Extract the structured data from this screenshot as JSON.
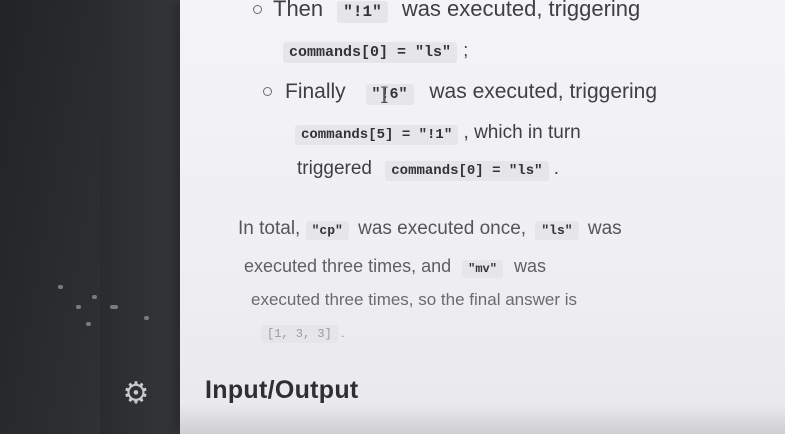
{
  "step_then": {
    "word": "Then",
    "cmd": "\"!1\"",
    "text": "was executed, triggering",
    "trigger": "commands[0] = \"ls\"",
    "punct": ";"
  },
  "step_finally": {
    "word": "Finally",
    "cmd": "\"!6\"",
    "text": "was executed, triggering",
    "trigger": "commands[5] = \"!1\"",
    "rest": ", which in turn",
    "word2": "triggered",
    "trigger2": "commands[0] = \"ls\"",
    "punct": "."
  },
  "summary": {
    "part1": "In total,",
    "cp": "\"cp\"",
    "part2": "was executed once,",
    "ls": "\"ls\"",
    "part3": "was",
    "part4": "executed three times, and",
    "mv": "\"mv\"",
    "part5": "was",
    "part6": "executed three times, so the final answer is",
    "answer": "[1, 3, 3]",
    "part7": "."
  },
  "section": {
    "heading": "Input/Output"
  },
  "icons": {
    "settings": "gear-icon"
  }
}
